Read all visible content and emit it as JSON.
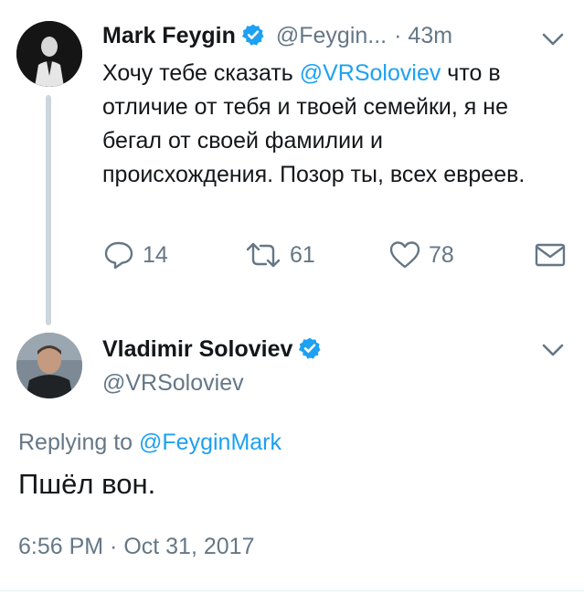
{
  "tweet1": {
    "author_name": "Mark Feygin",
    "handle": "@Feygin...",
    "time": "· 43m",
    "text_before": "Хочу тебе сказать ",
    "mention": "@VRSoloviev",
    "text_after": " что в отличие от тебя и твоей семейки, я не бегал от своей фамилии и происхождения. Позор ты, всех евреев.",
    "replies": "14",
    "retweets": "61",
    "likes": "78"
  },
  "tweet2": {
    "author_name": "Vladimir Soloviev",
    "handle": "@VRSoloviev",
    "replying_prefix": "Replying to ",
    "replying_to": "@FeyginMark",
    "text": "Пшёл вон.",
    "timestamp": "6:56 PM · Oct 31, 2017"
  },
  "colors": {
    "accent": "#1da1f2",
    "secondary_text": "#657786",
    "thread_line": "#ccd6dd"
  }
}
